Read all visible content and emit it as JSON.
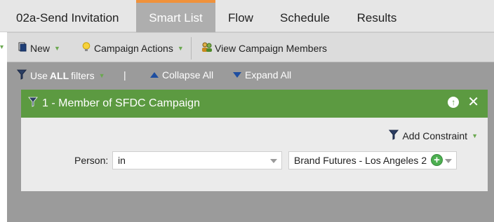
{
  "tabs": [
    {
      "label": "02a-Send Invitation",
      "active": false
    },
    {
      "label": "Smart List",
      "active": true
    },
    {
      "label": "Flow",
      "active": false
    },
    {
      "label": "Schedule",
      "active": false
    },
    {
      "label": "Results",
      "active": false
    }
  ],
  "toolbar": {
    "new_label": "New",
    "campaign_actions_label": "Campaign Actions",
    "view_members_label": "View Campaign Members"
  },
  "filterbar": {
    "use_prefix": "Use",
    "use_bold": "ALL",
    "use_suffix": "filters",
    "separator": "|",
    "collapse_label": "Collapse All",
    "expand_label": "Expand All"
  },
  "filter": {
    "title": "1 - Member of SFDC Campaign",
    "add_constraint_label": "Add Constraint",
    "person_label": "Person:",
    "operator_value": "in",
    "campaign_value": "Brand Futures - Los Angeles 2"
  },
  "colors": {
    "tab_active_bg": "#aeaeae",
    "tab_accent": "#f0923b",
    "filter_header": "#5c9a41",
    "main_bg": "#9b9b9b"
  }
}
